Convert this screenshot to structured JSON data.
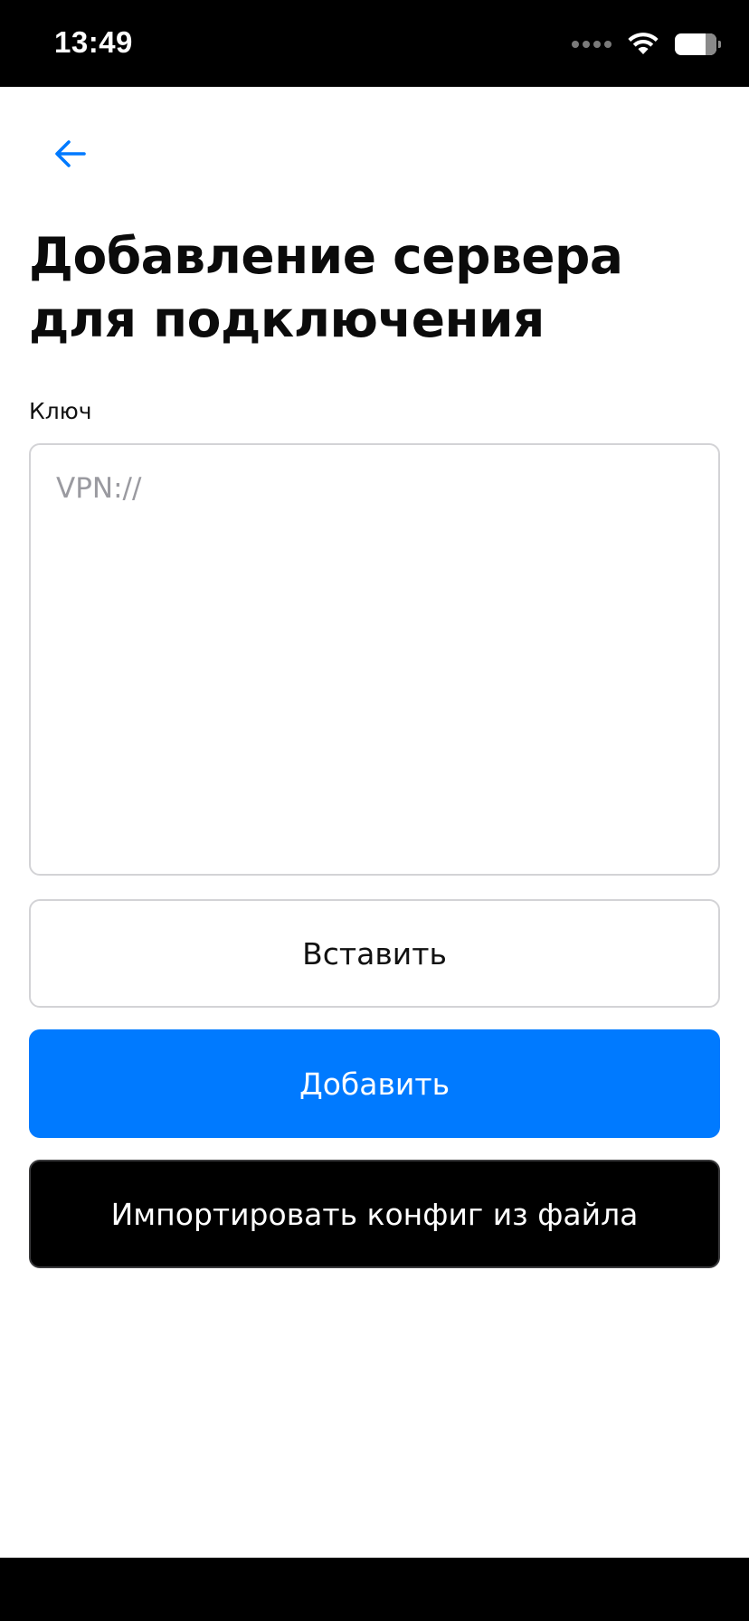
{
  "status_bar": {
    "time": "13:49"
  },
  "nav": {
    "back_icon": "arrow-left-icon"
  },
  "page": {
    "title": "Добавление сервера для подключения"
  },
  "form": {
    "key_label": "Ключ",
    "key_placeholder": "VPN://",
    "key_value": ""
  },
  "buttons": {
    "paste_label": "Вставить",
    "add_label": "Добавить",
    "import_label": "Импортировать конфиг из файла"
  },
  "colors": {
    "accent": "#007aff",
    "import_button_bg": "#000000",
    "border": "#d3d3d6"
  }
}
